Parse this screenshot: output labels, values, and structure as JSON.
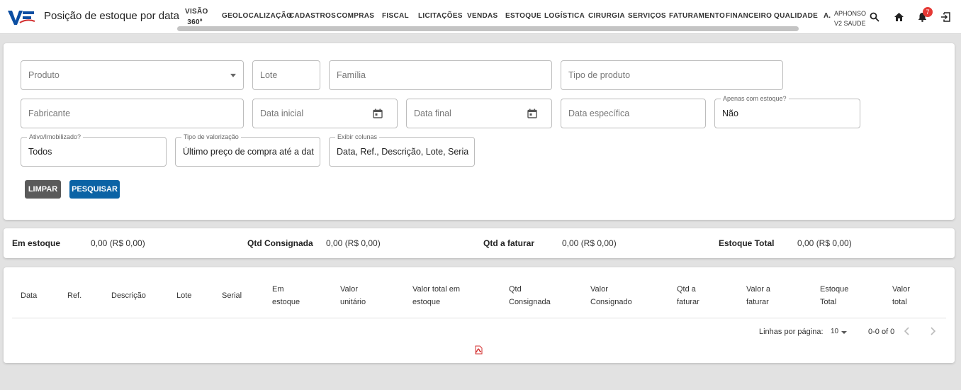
{
  "header": {
    "title": "Posição de estoque por data",
    "nav": [
      {
        "label": "VISÃO 360º",
        "two": true
      },
      {
        "label": "GEOLOCALIZAÇÃO"
      },
      {
        "label": "CADASTROS"
      },
      {
        "label": "COMPRAS"
      },
      {
        "label": "FISCAL"
      },
      {
        "label": "LICITAÇÕES"
      },
      {
        "label": "VENDAS"
      },
      {
        "label": "ESTOQUE"
      },
      {
        "label": "LOGÍSTICA"
      },
      {
        "label": "CIRURGIA"
      },
      {
        "label": "SERVIÇOS"
      },
      {
        "label": "FATURAMENTO"
      },
      {
        "label": "FINANCEIRO"
      },
      {
        "label": "QUALIDADE"
      }
    ],
    "nav_overflow": "A.",
    "user_name": "APHONSO",
    "user_company": "V2 SAUDE",
    "notification_count": "7",
    "icons": [
      "search-icon",
      "home-icon",
      "bell-icon",
      "logout-icon"
    ]
  },
  "filters": {
    "produto": "Produto",
    "lote": "Lote",
    "familia": "Família",
    "tipo_produto": "Tipo de produto",
    "fabricante": "Fabricante",
    "data_inicial": "Data inicial",
    "data_final": "Data final",
    "data_especifica": "Data específica",
    "apenas_estoque_label": "Apenas com estoque?",
    "apenas_estoque_value": "Não",
    "ativo_label": "Ativo/Imobilizado?",
    "ativo_value": "Todos",
    "valorizacao_label": "Tipo de valorização",
    "valorizacao_value": "Último preço de compra até a data",
    "colunas_label": "Exibir colunas",
    "colunas_value": "Data, Ref., Descrição, Lote, Serial, Em estoque",
    "btn_limpar": "LIMPAR",
    "btn_pesquisar": "PESQUISAR"
  },
  "totals": {
    "em_estoque_label": "Em estoque",
    "em_estoque_value": "0,00 (R$ 0,00)",
    "consignada_label": "Qtd Consignada",
    "consignada_value": "0,00 (R$ 0,00)",
    "faturar_label": "Qtd a faturar",
    "faturar_value": "0,00 (R$ 0,00)",
    "total_label": "Estoque Total",
    "total_value": "0,00 (R$ 0,00)"
  },
  "table": {
    "columns": [
      [
        "Data"
      ],
      [
        "Ref."
      ],
      [
        "Descrição"
      ],
      [
        "Lote"
      ],
      [
        "Serial"
      ],
      [
        "Em",
        "estoque"
      ],
      [
        "Valor",
        "unitário"
      ],
      [
        "Valor total em",
        "estoque"
      ],
      [
        "Qtd",
        "Consignada"
      ],
      [
        "Valor",
        "Consignado"
      ],
      [
        "Qtd a",
        "faturar"
      ],
      [
        "Valor a",
        "faturar"
      ],
      [
        "Estoque",
        "Total"
      ],
      [
        "Valor",
        "total"
      ]
    ],
    "rows_per_page_label": "Linhas por página:",
    "rows_per_page_value": "10",
    "range": "0-0 of 0"
  }
}
